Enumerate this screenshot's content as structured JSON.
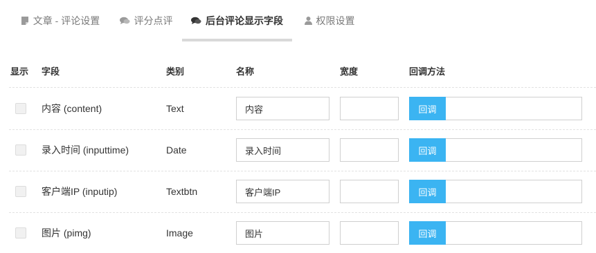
{
  "tabs": [
    {
      "label": "文章 - 评论设置",
      "icon": "document-icon",
      "active": false
    },
    {
      "label": "评分点评",
      "icon": "comments-icon",
      "active": false
    },
    {
      "label": "后台评论显示字段",
      "icon": "comments-icon",
      "active": true
    },
    {
      "label": "权限设置",
      "icon": "user-icon",
      "active": false
    }
  ],
  "table": {
    "headers": {
      "show": "显示",
      "field": "字段",
      "type": "类别",
      "name": "名称",
      "width": "宽度",
      "callback": "回调方法"
    },
    "rows": [
      {
        "checked": false,
        "field": "内容 (content)",
        "type": "Text",
        "name": "内容",
        "width": "",
        "callback_button": "回调",
        "callback_value": ""
      },
      {
        "checked": false,
        "field": "录入时间 (inputtime)",
        "type": "Date",
        "name": "录入时间",
        "width": "",
        "callback_button": "回调",
        "callback_value": ""
      },
      {
        "checked": false,
        "field": "客户端IP (inputip)",
        "type": "Textbtn",
        "name": "客户端IP",
        "width": "",
        "callback_button": "回调",
        "callback_value": ""
      },
      {
        "checked": false,
        "field": "图片 (pimg)",
        "type": "Image",
        "name": "图片",
        "width": "",
        "callback_button": "回调",
        "callback_value": ""
      }
    ]
  },
  "colors": {
    "accent": "#3bb4f2",
    "active_tab_underline": "#d9d9d9",
    "inactive_tab_text": "#7a7a7a"
  }
}
